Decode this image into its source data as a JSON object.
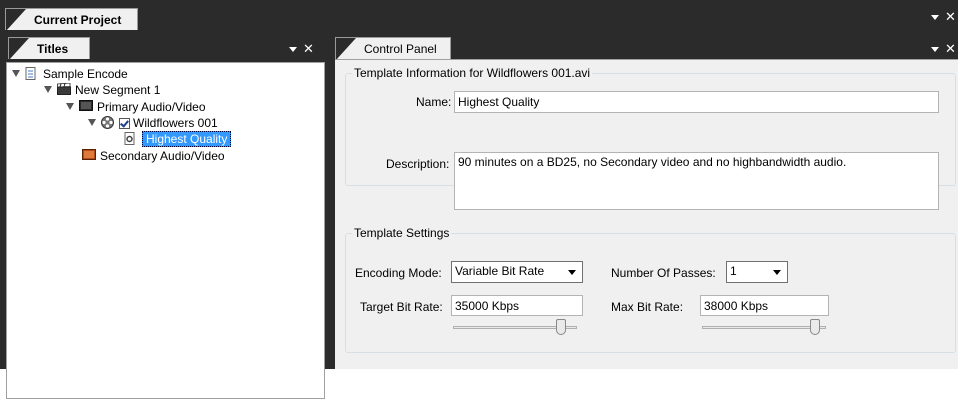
{
  "current_project": {
    "tab_label": "Current Project"
  },
  "titles_panel": {
    "tab_label": "Titles",
    "tree": {
      "root": "Sample Encode",
      "segment": "New Segment 1",
      "primary": "Primary Audio/Video",
      "wildflowers": "Wildflowers 001",
      "highest_quality": "Highest Quality",
      "secondary": "Secondary Audio/Video"
    }
  },
  "control_panel": {
    "tab_label": "Control Panel",
    "template_info": {
      "legend": "Template Information for Wildflowers 001.avi",
      "name_label": "Name:",
      "name_value": "Highest Quality",
      "description_label": "Description:",
      "description_value": "90 minutes on a BD25, no Secondary video and no highbandwidth audio."
    },
    "template_settings": {
      "legend": "Template Settings",
      "encoding_mode_label": "Encoding Mode:",
      "encoding_mode_value": "Variable Bit Rate",
      "passes_label": "Number Of Passes:",
      "passes_value": "1",
      "target_label": "Target Bit Rate:",
      "target_value": "35000 Kbps",
      "max_label": "Max Bit Rate:",
      "max_value": "38000 Kbps",
      "target_slider_level": 0.9,
      "max_slider_level": 0.95
    }
  },
  "icons": {
    "window_menu": "dropdown-arrow-icon",
    "window_close": "close-icon"
  },
  "colors": {
    "chrome": "#2b2b2b",
    "selection": "#3399ff",
    "panel_bg": "#f0f0f0"
  }
}
